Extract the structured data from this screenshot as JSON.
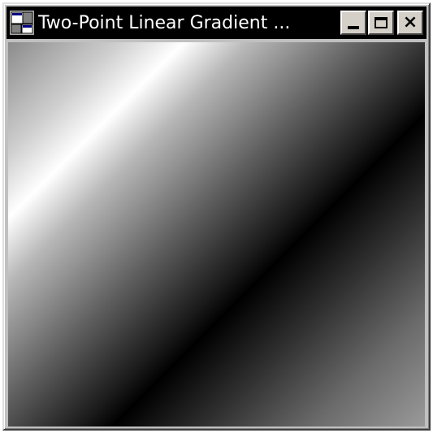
{
  "window": {
    "title": "Two-Point Linear Gradient ...",
    "icon": "application-window-icon"
  },
  "title_buttons": {
    "minimize": "minimize-icon",
    "maximize": "maximize-icon",
    "close": "×"
  },
  "client": {
    "content": "linear-gradient",
    "colors": {
      "light": "#ffffff",
      "dark": "#000000",
      "mid": "#8c8c8c"
    }
  }
}
